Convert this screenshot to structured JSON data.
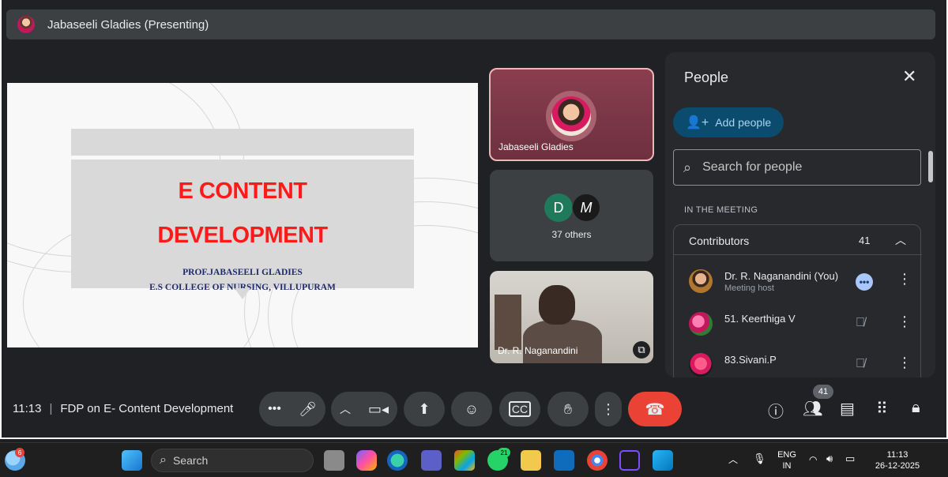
{
  "topbar": {
    "presenter_title": "Jabaseeli Gladies (Presenting)"
  },
  "slide": {
    "heading_line1": "E CONTENT",
    "heading_line2": "DEVELOPMENT",
    "subtitle_line1": "PROF.JABASEELI GLADIES",
    "subtitle_line2": "E.S COLLEGE OF NURSING, VILLUPURAM"
  },
  "tiles": {
    "presenter_name": "Jabaseeli Gladies",
    "others_initial_1": "D",
    "others_initial_2": "M",
    "others_count": "37 others",
    "camera_name": "Dr. R. Naganandini"
  },
  "people_panel": {
    "title": "People",
    "add_people": "Add people",
    "search_placeholder": "Search for people",
    "section_label": "IN THE MEETING",
    "group_label": "Contributors",
    "group_count": "41",
    "participants": [
      {
        "name": "Dr. R. Naganandini (You)",
        "role": "Meeting host"
      },
      {
        "name": "51. Keerthiga V",
        "role": ""
      },
      {
        "name": "83.Sivani.P",
        "role": ""
      }
    ]
  },
  "meeting_bar": {
    "time": "11:13",
    "meeting_name": "FDP on E- Content Development",
    "people_badge": "41"
  },
  "taskbar": {
    "weather_badge": "6",
    "search_label": "Search",
    "whatsapp_badge": "21",
    "lang_line1": "ENG",
    "lang_line2": "IN",
    "clock_time": "11:13",
    "clock_date": "26-12-2025"
  },
  "colors": {
    "meet_bg": "#202124",
    "panel_bg": "#28292c",
    "end_call": "#ea4335",
    "slide_heading": "#ff1a1a",
    "accent_blue": "#0a4b6e"
  }
}
